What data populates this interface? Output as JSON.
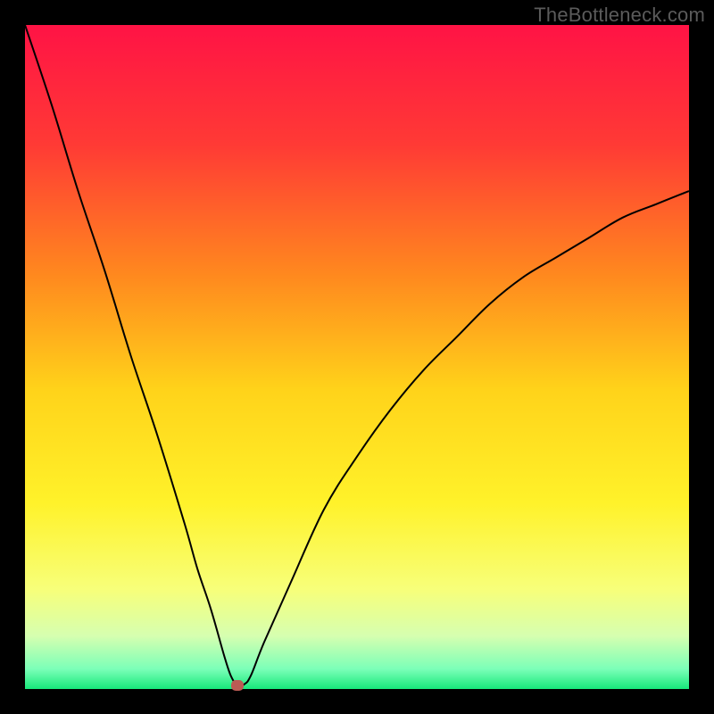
{
  "watermark": "TheBottleneck.com",
  "chart_data": {
    "type": "line",
    "title": "",
    "xlabel": "",
    "ylabel": "",
    "xlim": [
      0,
      100
    ],
    "ylim": [
      0,
      100
    ],
    "grid": false,
    "legend": false,
    "series": [
      {
        "name": "bottleneck-curve",
        "x": [
          0,
          4,
          8,
          12,
          16,
          20,
          24,
          26,
          28,
          30,
          31,
          32,
          33,
          34,
          36,
          40,
          45,
          50,
          55,
          60,
          65,
          70,
          75,
          80,
          85,
          90,
          95,
          100
        ],
        "y": [
          100,
          88,
          75,
          63,
          50,
          38,
          25,
          18,
          12,
          5,
          2,
          0.5,
          0.7,
          2,
          7,
          16,
          27,
          35,
          42,
          48,
          53,
          58,
          62,
          65,
          68,
          71,
          73,
          75
        ]
      }
    ],
    "marker": {
      "x": 32,
      "y": 0.5,
      "color": "#bb5b54"
    },
    "gradient": {
      "stops": [
        {
          "pct": 0,
          "color": "#ff1345"
        },
        {
          "pct": 18,
          "color": "#ff3a35"
        },
        {
          "pct": 38,
          "color": "#ff8a1e"
        },
        {
          "pct": 55,
          "color": "#ffd31a"
        },
        {
          "pct": 72,
          "color": "#fff22a"
        },
        {
          "pct": 85,
          "color": "#f7ff7a"
        },
        {
          "pct": 92,
          "color": "#d6ffb0"
        },
        {
          "pct": 97,
          "color": "#7bffb8"
        },
        {
          "pct": 100,
          "color": "#17e87a"
        }
      ]
    },
    "stroke": {
      "color": "#000000",
      "width": 2
    }
  }
}
